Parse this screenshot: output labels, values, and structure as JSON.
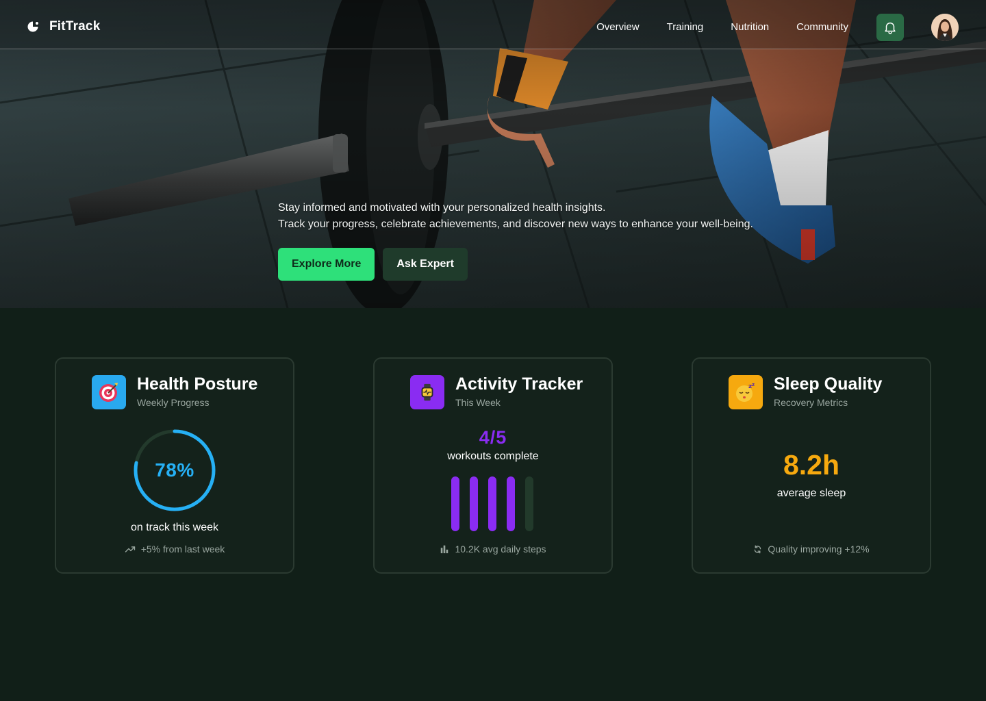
{
  "brand": {
    "name": "FitTrack"
  },
  "nav": {
    "links": [
      "Overview",
      "Training",
      "Nutrition",
      "Community"
    ],
    "notification_icon": "bell-icon",
    "avatar_icon": "user-avatar"
  },
  "hero": {
    "line1": "Stay informed and motivated with your personalized health insights.",
    "line2": "Track your progress, celebrate achievements, and discover new ways to enhance your well-being.",
    "primary_button": "Explore More",
    "secondary_button": "Ask Expert"
  },
  "cards": [
    {
      "title": "Health Posture",
      "subtitle": "Weekly Progress",
      "icon": "target-icon",
      "value": "78%",
      "progress": 0.78,
      "label": "on track this week",
      "footer": "+5% from last week",
      "footer_icon": "trending-up-icon",
      "accent": "#26b0f5"
    },
    {
      "title": "Activity Tracker",
      "subtitle": "This Week",
      "icon": "smartwatch-icon",
      "value": "4/5",
      "completed": 4,
      "total": 5,
      "label": "workouts complete",
      "footer": "10.2K avg daily steps",
      "footer_icon": "bar-chart-icon",
      "accent": "#8a2cf2"
    },
    {
      "title": "Sleep Quality",
      "subtitle": "Recovery Metrics",
      "icon": "sleeping-face-icon",
      "value": "8.2h",
      "label": "average sleep",
      "footer": "Quality improving +12%",
      "footer_icon": "refresh-icon",
      "accent": "#f6a90f"
    }
  ],
  "colors": {
    "background": "#111f18",
    "card": "#14221b",
    "primary_button": "#2ee07a",
    "secondary_button": "#1f3b2b",
    "bell_button": "#2a6a45"
  }
}
